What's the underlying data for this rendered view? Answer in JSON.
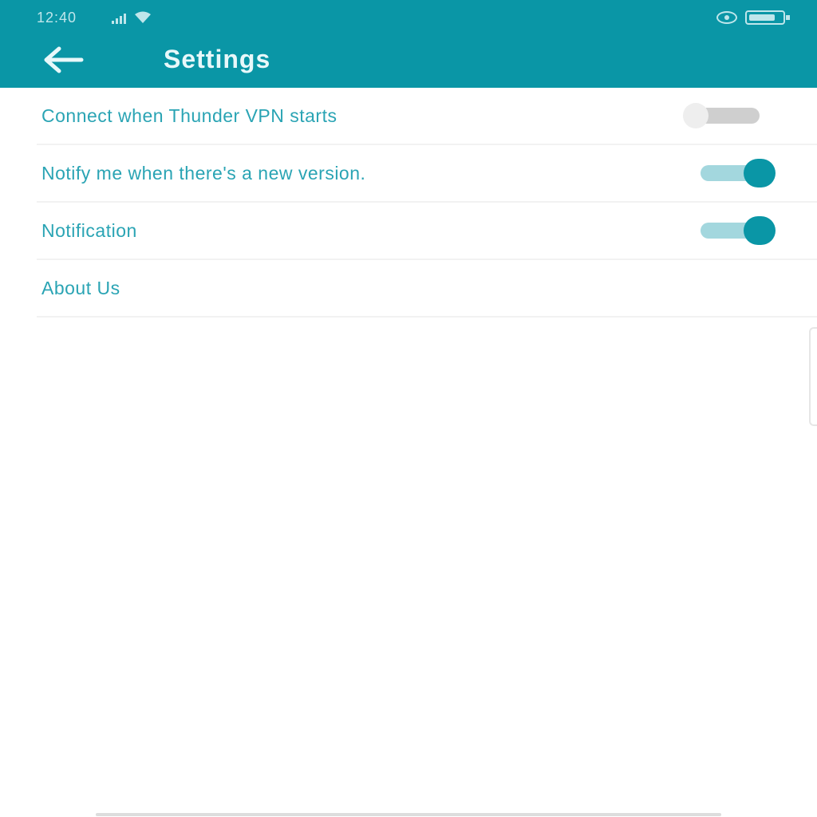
{
  "colors": {
    "primary": "#0a96a6",
    "label_text": "#2aa4b4",
    "toggle_on_track": "#a3d7de",
    "toggle_off_track": "#cfcfcf"
  },
  "status_bar": {
    "time": "12:40",
    "icons": [
      "signal-icon",
      "wifi-icon",
      "eye-icon",
      "battery-icon"
    ]
  },
  "header": {
    "back_icon": "arrow-left-icon",
    "title": "Settings"
  },
  "settings": {
    "items": [
      {
        "label": "Connect when Thunder VPN starts",
        "toggle": "off"
      },
      {
        "label": "Notify me when there's a new version.",
        "toggle": "on"
      },
      {
        "label": "Notification",
        "toggle": "on"
      },
      {
        "label": "About Us"
      }
    ]
  }
}
